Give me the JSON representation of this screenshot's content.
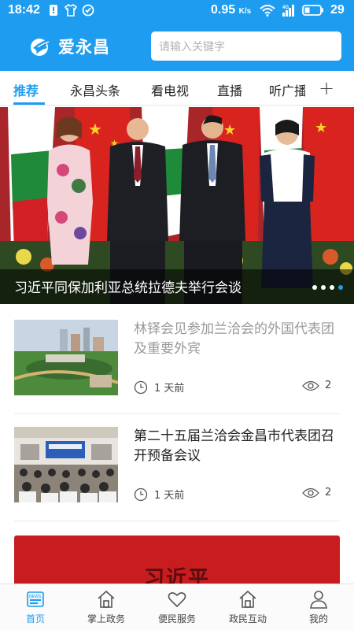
{
  "status_bar": {
    "time": "18:42",
    "speed": "0.95",
    "speed_unit": "K/s",
    "network": "4G",
    "battery": "29"
  },
  "header": {
    "app_name": "爱永昌",
    "search_placeholder": "请输入关键字"
  },
  "tabs": [
    {
      "label": "推荐",
      "active": true
    },
    {
      "label": "永昌头条"
    },
    {
      "label": "看电视"
    },
    {
      "label": "直播"
    },
    {
      "label": "听广播"
    }
  ],
  "tabs_add": "+",
  "banner": {
    "caption": "习近平同保加利亚总统拉德夫举行会谈",
    "slides": 4,
    "active_slide": 4
  },
  "news": [
    {
      "title": "林铎会见参加兰洽会的外国代表团及重要外宾",
      "time": "1 天前",
      "views": "2",
      "read": true
    },
    {
      "title": "第二十五届兰洽会金昌市代表团召开预备会议",
      "time": "1 天前",
      "views": "2",
      "read": false
    }
  ],
  "promo": {
    "text": "习近平"
  },
  "bottom_nav": [
    {
      "label": "首页",
      "icon": "home-news-icon",
      "active": true
    },
    {
      "label": "掌上政务",
      "icon": "house-icon"
    },
    {
      "label": "便民服务",
      "icon": "heart-icon"
    },
    {
      "label": "政民互动",
      "icon": "house-icon"
    },
    {
      "label": "我的",
      "icon": "person-icon"
    }
  ],
  "colors": {
    "accent": "#1e9df0",
    "banner_red": "#c81c1f"
  }
}
